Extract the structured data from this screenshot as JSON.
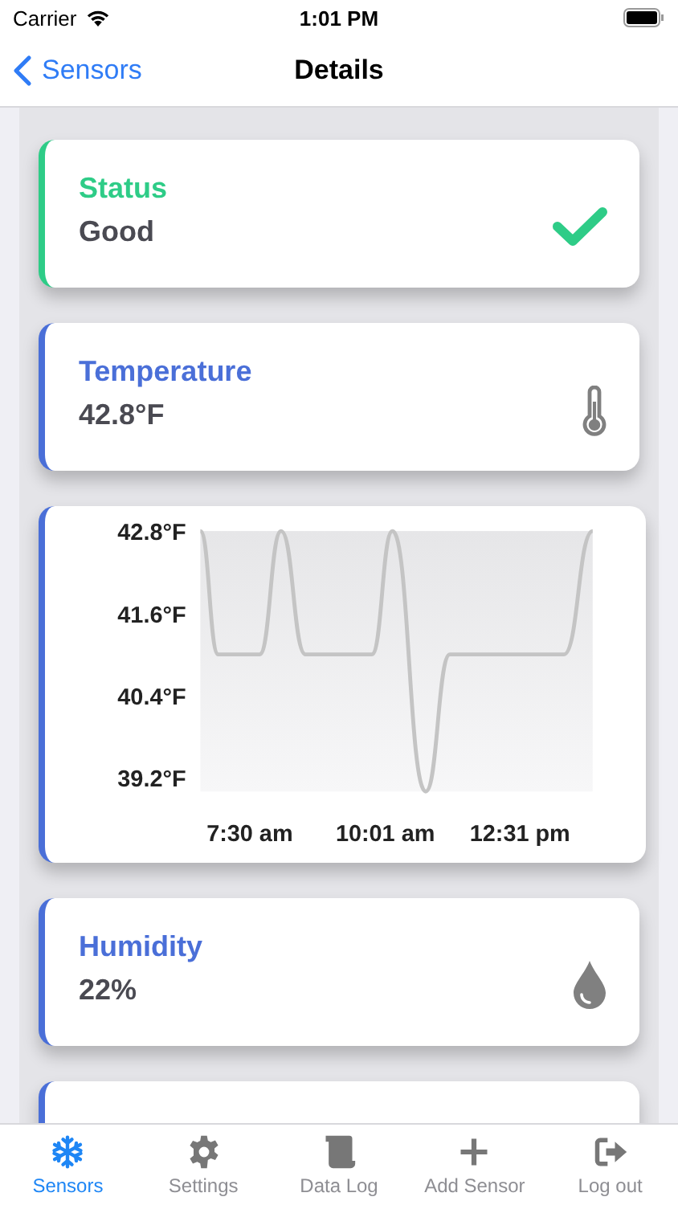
{
  "status_bar": {
    "carrier": "Carrier",
    "time": "1:01 PM"
  },
  "nav": {
    "back": "Sensors",
    "title": "Details"
  },
  "cards": [
    {
      "kind": "status",
      "title": "Status",
      "value": "Good",
      "color": "#2ecc87"
    },
    {
      "kind": "temperature",
      "title": "Temperature",
      "value": "42.8°F",
      "color": "#4a6fd8"
    },
    {
      "kind": "chart",
      "color": "#4a6fd8",
      "chart_data": {
        "type": "line",
        "x": [
          395,
          415,
          461,
          485,
          512,
          586,
          609,
          646,
          673,
          800,
          832
        ],
        "series": [
          {
            "color": "#c4c4c4",
            "values": [
              42.8,
              41.0,
              41.0,
              42.8,
              41.0,
              41.0,
              42.8,
              39.0,
              41.0,
              41.0,
              42.8
            ]
          }
        ],
        "xlim": [
          395,
          832
        ],
        "ylim": [
          39.0,
          42.8
        ],
        "xticks": [
          {
            "value": 450,
            "label": "7:30 am"
          },
          {
            "value": 601,
            "label": "10:01 am"
          },
          {
            "value": 751,
            "label": "12:31 pm"
          }
        ],
        "yticks": [
          {
            "value": 42.8,
            "label": "42.8°F"
          },
          {
            "value": 41.6,
            "label": "41.6°F"
          },
          {
            "value": 40.4,
            "label": "40.4°F"
          },
          {
            "value": 39.2,
            "label": "39.2°F"
          }
        ]
      }
    },
    {
      "kind": "humidity",
      "title": "Humidity",
      "value": "22%",
      "color": "#4a6fd8"
    },
    {
      "kind": "partial",
      "color": "#4a6fd8"
    }
  ],
  "tabs": [
    {
      "label": "Sensors",
      "selected": true
    },
    {
      "label": "Settings",
      "selected": false
    },
    {
      "label": "Data Log",
      "selected": false
    },
    {
      "label": "Add Sensor",
      "selected": false
    },
    {
      "label": "Log out",
      "selected": false
    }
  ]
}
